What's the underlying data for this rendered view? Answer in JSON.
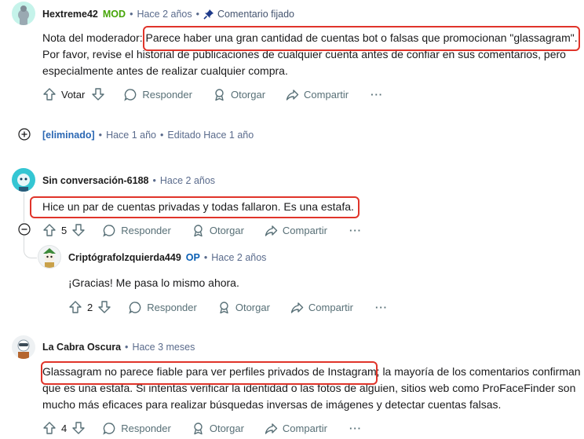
{
  "comments": [
    {
      "author": "Hextreme42",
      "badge": "MOD",
      "time": "Hace 2 años",
      "pinned_label": "Comentario fijado",
      "lines": [
        "Nota del moderador: Parece haber una gran cantidad de cuentas bot o falsas que promocionan \"glassagram\".",
        "Por favor, revise el historial de publicaciones de cualquier cuenta antes de confiar en sus comentarios, pero",
        "especialmente antes de realizar cualquier compra."
      ],
      "actions": {
        "vote": "Votar",
        "reply": "Responder",
        "award": "Otorgar",
        "share": "Compartir",
        "more": "···"
      }
    },
    {
      "author": "[eliminado]",
      "time": "Hace 1 año",
      "edited": "Editado Hace 1 año"
    },
    {
      "author": "Sin conversación-6188",
      "time": "Hace 2 años",
      "text": "Hice un par de cuentas privadas y todas fallaron. Es una estafa.",
      "votes": "5",
      "actions": {
        "reply": "Responder",
        "award": "Otorgar",
        "share": "Compartir",
        "more": "···"
      }
    },
    {
      "author": "Criptógrafolzquierda449",
      "badge": "OP",
      "time": "Hace 2 años",
      "text": "¡Gracias! Me pasa lo mismo ahora.",
      "votes": "2",
      "actions": {
        "reply": "Responder",
        "award": "Otorgar",
        "share": "Compartir",
        "more": "···"
      }
    },
    {
      "author": "La Cabra Oscura",
      "time": "Hace 3 meses",
      "lines": [
        "Glassagram no parece fiable para ver perfiles privados de Instagram; la mayoría de los comentarios confirman",
        "que es una estafa. Si intentas verificar la identidad o las fotos de alguien, sitios web como ProFaceFinder son",
        "mucho más eficaces para realizar búsquedas inversas de imágenes y detectar cuentas falsas."
      ],
      "votes": "4",
      "actions": {
        "reply": "Responder",
        "award": "Otorgar",
        "share": "Compartir",
        "more": "···"
      }
    }
  ],
  "dot": "•",
  "colors": {
    "highlight": "#e0342a",
    "mod": "#46a508",
    "op": "#0a5fb4",
    "meta": "#5a6b8c"
  }
}
